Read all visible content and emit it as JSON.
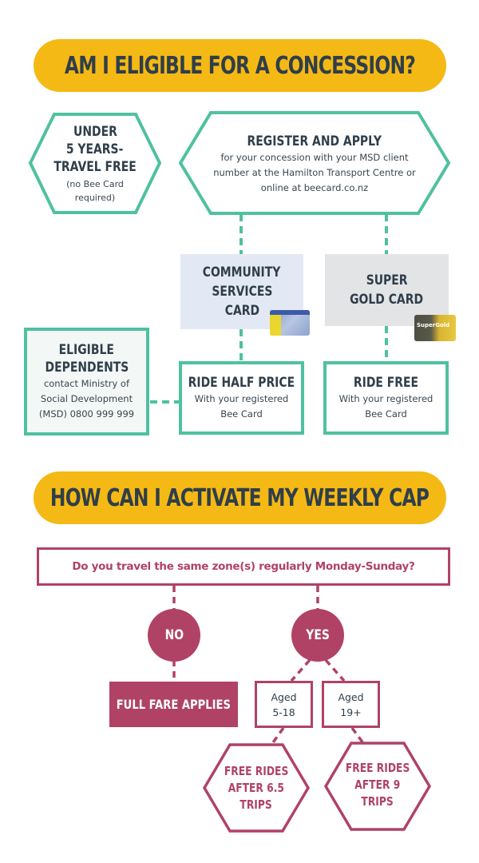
{
  "colors": {
    "teal": "#4fc1a0",
    "gold": "#f5b915",
    "text_dark": "#2f3e4a",
    "maroon": "#b04266",
    "community_card_bg": "#e3e9f4",
    "gold_card_bg": "#e3e4e6",
    "dependents_bg": "#f3f8f6"
  },
  "section1": {
    "title": "AM I ELIGIBLE FOR A CONCESSION?",
    "under5": {
      "line1": "UNDER",
      "line2": "5 YEARS-",
      "line3": "TRAVEL FREE",
      "note1": "(no Bee Card",
      "note2": "required)"
    },
    "register": {
      "title": "REGISTER AND APPLY",
      "line1": "for your concession with your MSD client",
      "line2": "number at the Hamilton Transport Centre or",
      "line3": "online at beecard.co.nz"
    },
    "community_card": {
      "line1": "COMMUNITY",
      "line2": "SERVICES",
      "line3": "CARD",
      "image": "community-services-card-image"
    },
    "gold_card": {
      "line1": "SUPER",
      "line2": "GOLD CARD",
      "image": "supergold-card-image",
      "image_text": "SuperGold"
    },
    "dependents": {
      "line1": "ELIGIBLE",
      "line2": "DEPENDENTS",
      "text1": "contact Ministry of",
      "text2": "Social Development",
      "text3": "(MSD) 0800 999 999"
    },
    "half_price": {
      "title": "RIDE HALF PRICE",
      "text1": "With your registered",
      "text2": "Bee Card"
    },
    "ride_free": {
      "title": "RIDE FREE",
      "text1": "With your registered",
      "text2": "Bee Card"
    }
  },
  "section2": {
    "title": "HOW CAN I ACTIVATE MY WEEKLY CAP",
    "question": "Do you travel the same zone(s) regularly Monday-Sunday?",
    "no": "NO",
    "yes": "YES",
    "full_fare": "FULL FARE APPLIES",
    "aged_young": {
      "line1": "Aged",
      "line2": "5-18"
    },
    "aged_adult": {
      "line1": "Aged",
      "line2": "19+"
    },
    "free_young": {
      "line1": "FREE RIDES",
      "line2": "AFTER 6.5",
      "line3": "TRIPS"
    },
    "free_adult": {
      "line1": "FREE RIDES",
      "line2": "AFTER 9",
      "line3": "TRIPS"
    }
  }
}
